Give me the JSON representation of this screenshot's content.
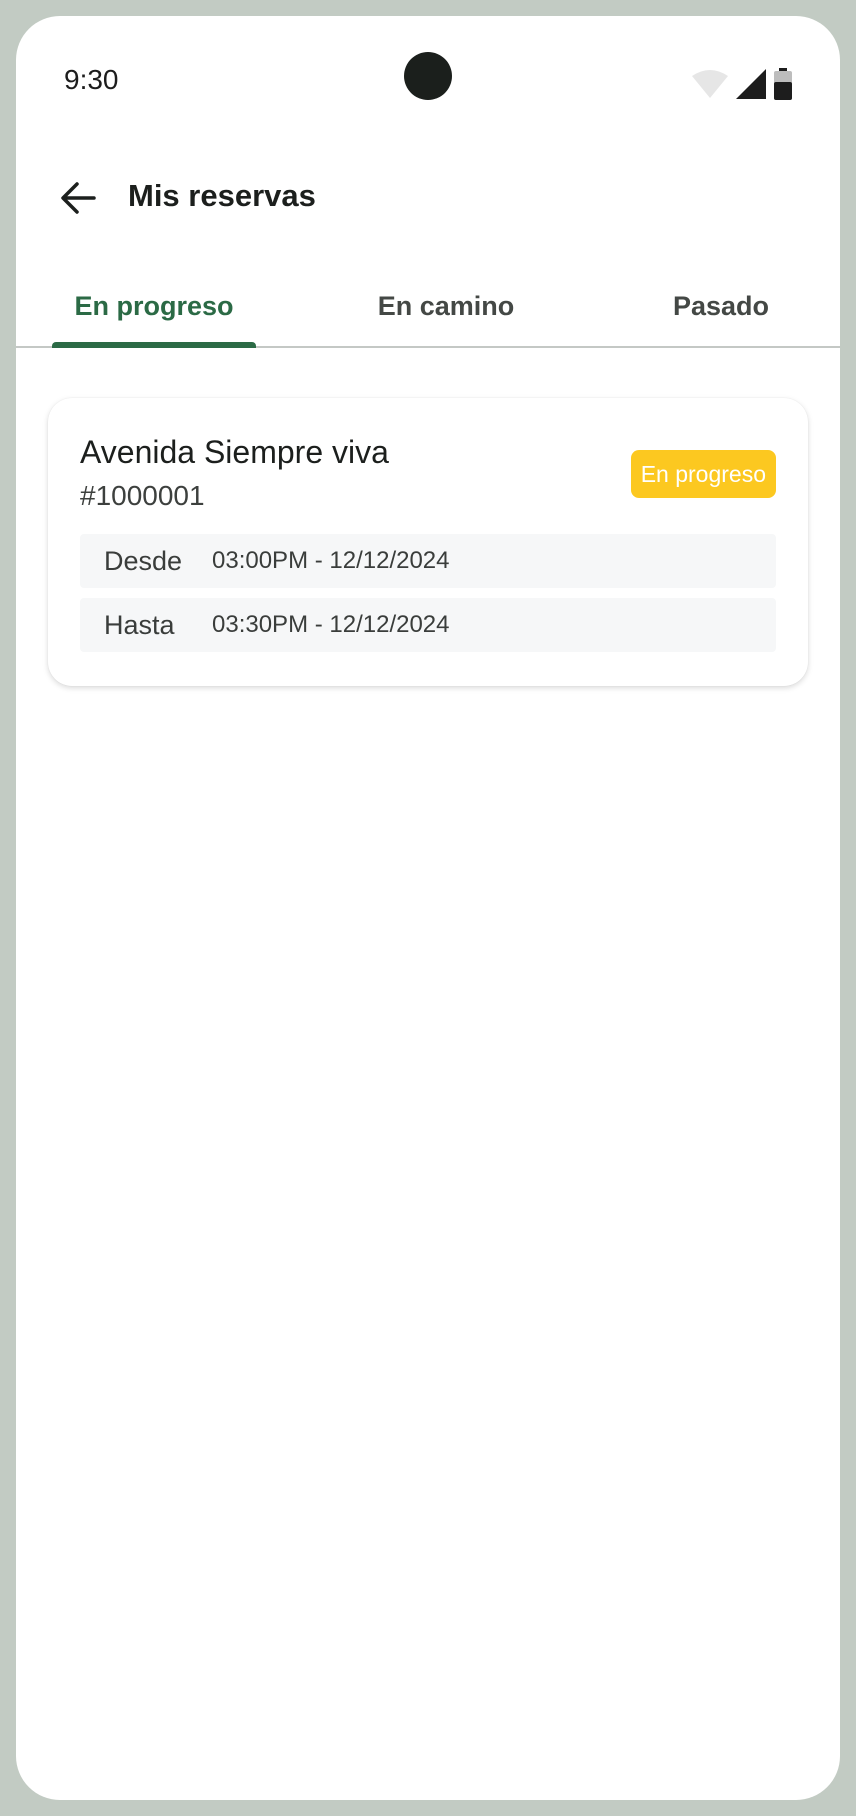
{
  "status_bar": {
    "time": "9:30"
  },
  "app_bar": {
    "back_icon": "arrow-left-icon",
    "title": "Mis reservas"
  },
  "tabs": [
    {
      "label": "En progreso",
      "active": true
    },
    {
      "label": "En camino",
      "active": false
    },
    {
      "label": "Pasado",
      "active": false
    }
  ],
  "colors": {
    "accent": "#2b6a45",
    "badge": "#fcc820",
    "frame": "#c2cbc3"
  },
  "reservations": [
    {
      "title": "Avenida Siempre viva",
      "id": "#1000001",
      "status": "En progreso",
      "from_label": "Desde",
      "from_value": "03:00PM - 12/12/2024",
      "to_label": "Hasta",
      "to_value": "03:30PM - 12/12/2024"
    }
  ]
}
